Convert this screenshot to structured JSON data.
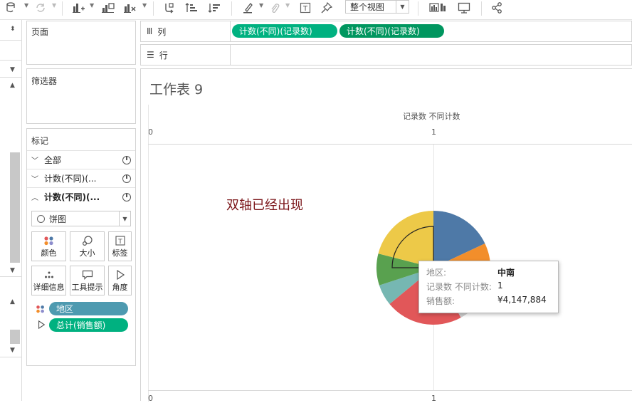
{
  "toolbar": {
    "icons": [
      "datasource-icon",
      "refresh-icon",
      "new-sheet-icon",
      "new-dashboard-icon",
      "clear-sheet-icon",
      "swap-icon",
      "sort-asc-icon",
      "sort-desc-icon",
      "highlight-icon",
      "paperclip-icon",
      "label-icon",
      "pin-icon",
      "show-me-icon",
      "presentation-icon",
      "share-icon"
    ],
    "view_select": "整个视图"
  },
  "panels": {
    "pages_title": "页面",
    "filters_title": "筛选器",
    "marks_title": "标记",
    "marks_rows": [
      {
        "label": "全部",
        "expanded": false
      },
      {
        "label": "计数(不同)(...",
        "expanded": false
      },
      {
        "label": "计数(不同)(...",
        "expanded": true
      }
    ],
    "mark_type": "饼图",
    "mark_buttons": [
      {
        "label": "颜色",
        "icon": "color-icon"
      },
      {
        "label": "大小",
        "icon": "size-icon"
      },
      {
        "label": "标签",
        "icon": "label-icon"
      },
      {
        "label": "详细信息",
        "icon": "detail-icon"
      },
      {
        "label": "工具提示",
        "icon": "tooltip-icon"
      },
      {
        "label": "角度",
        "icon": "angle-icon"
      }
    ],
    "mark_pills": [
      {
        "label": "地区",
        "color": "#4e9ab0"
      },
      {
        "label": "总计(销售额)",
        "color": "#00b180"
      }
    ]
  },
  "shelves": {
    "columns_label": "列",
    "rows_label": "行",
    "column_pills": [
      {
        "label": "计数(不同)(记录数)",
        "color": "#00b180"
      },
      {
        "label": "计数(不同)(记录数)",
        "color": "#00965f"
      }
    ]
  },
  "sheet": {
    "title": "工作表 9",
    "axis_title": "记录数 不同计数",
    "annotation": "双轴已经出现",
    "top_ticks": [
      "0",
      "1"
    ],
    "bottom_ticks": [
      "0",
      "1"
    ]
  },
  "chart_data": {
    "type": "pie",
    "slices": [
      {
        "color": "#4e79a7",
        "fraction": 0.18
      },
      {
        "color": "#f28e2b",
        "fraction": 0.1
      },
      {
        "color": "#d0d0d0",
        "fraction": 0.14
      },
      {
        "color": "#e15759",
        "fraction": 0.22
      },
      {
        "color": "#76b7b2",
        "fraction": 0.06
      },
      {
        "color": "#59a14f",
        "fraction": 0.09
      },
      {
        "color": "#edc948",
        "fraction": 0.21
      }
    ],
    "highlight_slice": "中南"
  },
  "tooltip": {
    "rows": [
      {
        "key": "地区:",
        "value": "中南"
      },
      {
        "key": "记录数 不同计数:",
        "value": "1"
      },
      {
        "key": "销售额:",
        "value": "¥4,147,884"
      }
    ]
  }
}
